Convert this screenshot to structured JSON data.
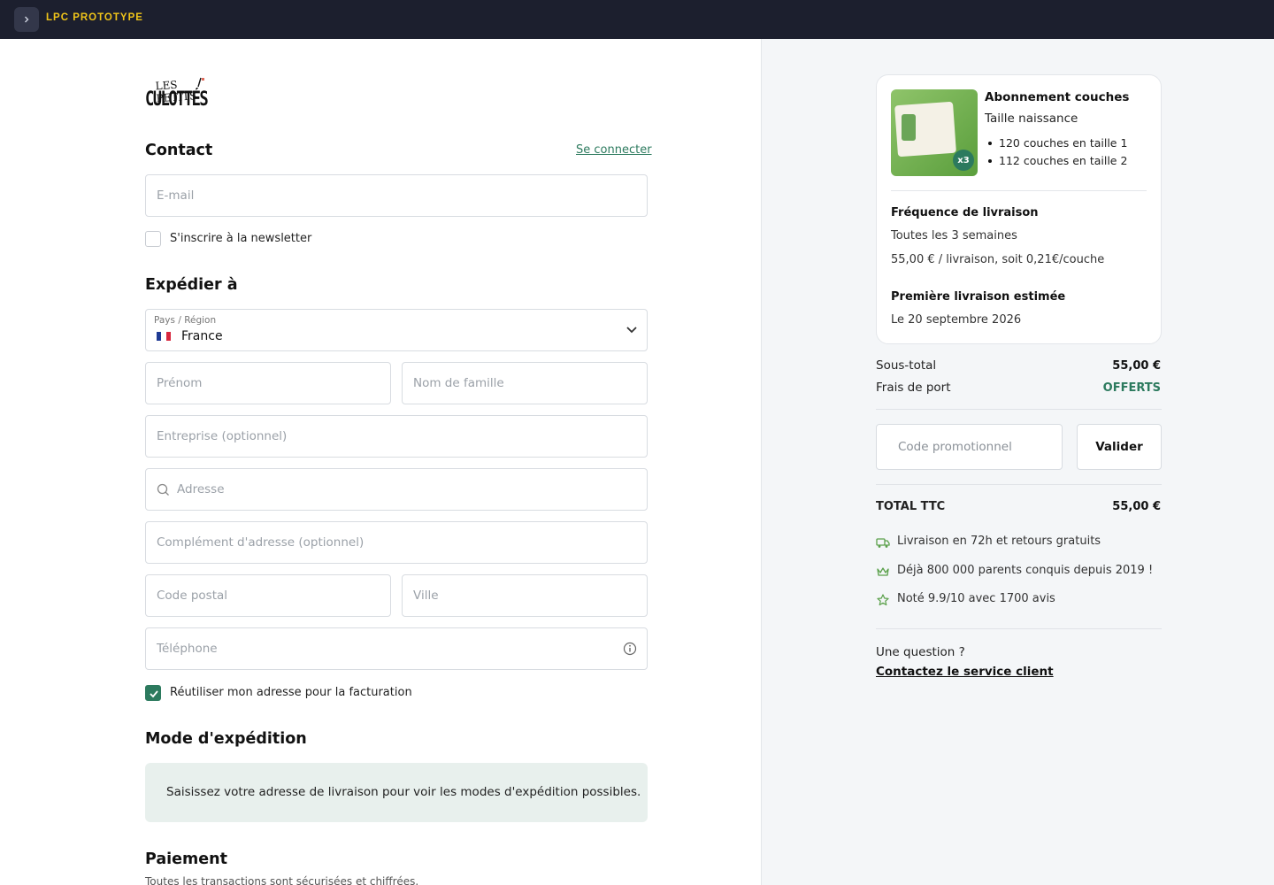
{
  "topbar": {
    "title": "LPC PROTOTYPE"
  },
  "logo": {
    "line1": "LES PETITS",
    "line2": "CULOTTÉS"
  },
  "contact": {
    "title": "Contact",
    "login_link": "Se connecter",
    "email_placeholder": "E-mail",
    "newsletter_label": "S'inscrire à la newsletter"
  },
  "shipping": {
    "title": "Expédier à",
    "country_label": "Pays / Région",
    "country_value": "France",
    "first_name_placeholder": "Prénom",
    "last_name_placeholder": "Nom de famille",
    "company_placeholder": "Entreprise (optionnel)",
    "address_placeholder": "Adresse",
    "address2_placeholder": "Complément d'adresse (optionnel)",
    "postal_placeholder": "Code postal",
    "city_placeholder": "Ville",
    "phone_placeholder": "Téléphone",
    "reuse_billing_label": "Réutiliser mon adresse pour la facturation"
  },
  "shipping_method": {
    "title": "Mode d'expédition",
    "info": "Saisissez votre adresse de livraison pour voir les modes d'expédition possibles."
  },
  "payment": {
    "title": "Paiement",
    "subtitle": "Toutes les transactions sont sécurisées et chiffrées."
  },
  "summary": {
    "product_title": "Abonnement couches",
    "product_subtitle": "Taille naissance",
    "product_items": [
      "120 couches en taille 1",
      "112 couches en taille 2"
    ],
    "product_badge": "x3",
    "frequency_label": "Fréquence de livraison",
    "frequency_value": "Toutes les 3 semaines",
    "price_line": "55,00 € / livraison, soit 0,21€/couche",
    "first_delivery_label": "Première livraison estimée",
    "first_delivery_value": "Le 20 septembre 2026",
    "subtotal_label": "Sous-total",
    "subtotal_value": "55,00 €",
    "shipping_label": "Frais de port",
    "shipping_value": "OFFERTS",
    "promo_placeholder": "Code promotionnel",
    "promo_button": "Valider",
    "total_label": "TOTAL TTC",
    "total_value": "55,00 €",
    "perks": [
      "Livraison en 72h et retours gratuits",
      "Déjà 800 000 parents conquis depuis 2019 !",
      "Noté 9.9/10 avec 1700 avis"
    ],
    "question": "Une question ?",
    "contact_link": "Contactez le service client"
  },
  "colors": {
    "accent": "#2c7a5e",
    "topbar": "#1c1f2e",
    "brand": "#f0c419"
  }
}
